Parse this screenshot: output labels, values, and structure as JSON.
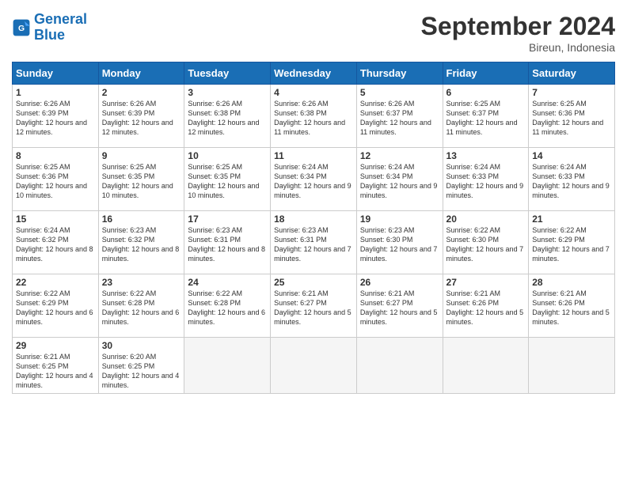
{
  "header": {
    "logo_text_general": "General",
    "logo_text_blue": "Blue",
    "month": "September 2024",
    "location": "Bireun, Indonesia"
  },
  "weekdays": [
    "Sunday",
    "Monday",
    "Tuesday",
    "Wednesday",
    "Thursday",
    "Friday",
    "Saturday"
  ],
  "weeks": [
    [
      {
        "day": "1",
        "sunrise": "6:26 AM",
        "sunset": "6:39 PM",
        "daylight": "12 hours and 12 minutes."
      },
      {
        "day": "2",
        "sunrise": "6:26 AM",
        "sunset": "6:39 PM",
        "daylight": "12 hours and 12 minutes."
      },
      {
        "day": "3",
        "sunrise": "6:26 AM",
        "sunset": "6:38 PM",
        "daylight": "12 hours and 12 minutes."
      },
      {
        "day": "4",
        "sunrise": "6:26 AM",
        "sunset": "6:38 PM",
        "daylight": "12 hours and 11 minutes."
      },
      {
        "day": "5",
        "sunrise": "6:26 AM",
        "sunset": "6:37 PM",
        "daylight": "12 hours and 11 minutes."
      },
      {
        "day": "6",
        "sunrise": "6:25 AM",
        "sunset": "6:37 PM",
        "daylight": "12 hours and 11 minutes."
      },
      {
        "day": "7",
        "sunrise": "6:25 AM",
        "sunset": "6:36 PM",
        "daylight": "12 hours and 11 minutes."
      }
    ],
    [
      {
        "day": "8",
        "sunrise": "6:25 AM",
        "sunset": "6:36 PM",
        "daylight": "12 hours and 10 minutes."
      },
      {
        "day": "9",
        "sunrise": "6:25 AM",
        "sunset": "6:35 PM",
        "daylight": "12 hours and 10 minutes."
      },
      {
        "day": "10",
        "sunrise": "6:25 AM",
        "sunset": "6:35 PM",
        "daylight": "12 hours and 10 minutes."
      },
      {
        "day": "11",
        "sunrise": "6:24 AM",
        "sunset": "6:34 PM",
        "daylight": "12 hours and 9 minutes."
      },
      {
        "day": "12",
        "sunrise": "6:24 AM",
        "sunset": "6:34 PM",
        "daylight": "12 hours and 9 minutes."
      },
      {
        "day": "13",
        "sunrise": "6:24 AM",
        "sunset": "6:33 PM",
        "daylight": "12 hours and 9 minutes."
      },
      {
        "day": "14",
        "sunrise": "6:24 AM",
        "sunset": "6:33 PM",
        "daylight": "12 hours and 9 minutes."
      }
    ],
    [
      {
        "day": "15",
        "sunrise": "6:24 AM",
        "sunset": "6:32 PM",
        "daylight": "12 hours and 8 minutes."
      },
      {
        "day": "16",
        "sunrise": "6:23 AM",
        "sunset": "6:32 PM",
        "daylight": "12 hours and 8 minutes."
      },
      {
        "day": "17",
        "sunrise": "6:23 AM",
        "sunset": "6:31 PM",
        "daylight": "12 hours and 8 minutes."
      },
      {
        "day": "18",
        "sunrise": "6:23 AM",
        "sunset": "6:31 PM",
        "daylight": "12 hours and 7 minutes."
      },
      {
        "day": "19",
        "sunrise": "6:23 AM",
        "sunset": "6:30 PM",
        "daylight": "12 hours and 7 minutes."
      },
      {
        "day": "20",
        "sunrise": "6:22 AM",
        "sunset": "6:30 PM",
        "daylight": "12 hours and 7 minutes."
      },
      {
        "day": "21",
        "sunrise": "6:22 AM",
        "sunset": "6:29 PM",
        "daylight": "12 hours and 7 minutes."
      }
    ],
    [
      {
        "day": "22",
        "sunrise": "6:22 AM",
        "sunset": "6:29 PM",
        "daylight": "12 hours and 6 minutes."
      },
      {
        "day": "23",
        "sunrise": "6:22 AM",
        "sunset": "6:28 PM",
        "daylight": "12 hours and 6 minutes."
      },
      {
        "day": "24",
        "sunrise": "6:22 AM",
        "sunset": "6:28 PM",
        "daylight": "12 hours and 6 minutes."
      },
      {
        "day": "25",
        "sunrise": "6:21 AM",
        "sunset": "6:27 PM",
        "daylight": "12 hours and 5 minutes."
      },
      {
        "day": "26",
        "sunrise": "6:21 AM",
        "sunset": "6:27 PM",
        "daylight": "12 hours and 5 minutes."
      },
      {
        "day": "27",
        "sunrise": "6:21 AM",
        "sunset": "6:26 PM",
        "daylight": "12 hours and 5 minutes."
      },
      {
        "day": "28",
        "sunrise": "6:21 AM",
        "sunset": "6:26 PM",
        "daylight": "12 hours and 5 minutes."
      }
    ],
    [
      {
        "day": "29",
        "sunrise": "6:21 AM",
        "sunset": "6:25 PM",
        "daylight": "12 hours and 4 minutes."
      },
      {
        "day": "30",
        "sunrise": "6:20 AM",
        "sunset": "6:25 PM",
        "daylight": "12 hours and 4 minutes."
      },
      null,
      null,
      null,
      null,
      null
    ]
  ]
}
